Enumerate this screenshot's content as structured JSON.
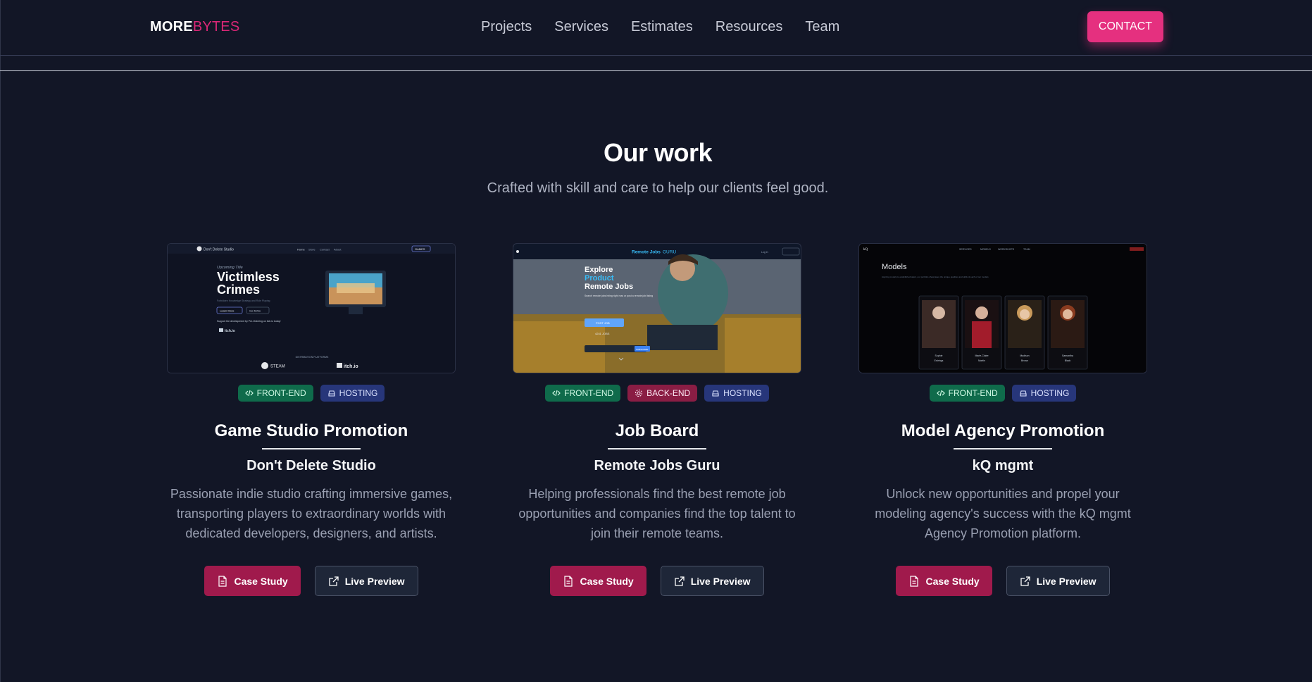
{
  "nav": {
    "logo_a": "MORE",
    "logo_b": "BYTES",
    "items": [
      "Projects",
      "Services",
      "Estimates",
      "Resources",
      "Team"
    ],
    "contact": "CONTACT"
  },
  "section": {
    "title": "Our work",
    "subtitle": "Crafted with skill and care to help our clients feel good."
  },
  "projects": [
    {
      "tags": [
        "FRONT-END",
        "HOSTING"
      ],
      "title": "Game Studio Promotion",
      "client": "Don't Delete Studio",
      "description": "Passionate indie studio crafting immersive games, transporting players to extraordinary worlds with dedicated developers, designers, and artists.",
      "case_label": "Case Study",
      "live_label": "Live Preview",
      "preview": {
        "brand": "Don't Delete Studio",
        "nav": [
          "Home",
          "Store",
          "Contact",
          "About"
        ],
        "badge": "GAMES",
        "eyebrow": "Upcoming Title",
        "headline": "Victimless Crimes",
        "tagline": "Forbidden Knowledge Strategy and Role Playing",
        "btn1": "Learn More",
        "btn2": "Go Itchio",
        "support": "Support the development by Pre-Ordering on itch.io today!",
        "itch_small": "itch.io",
        "platforms_label": "DISTRIBUTION PLATFORMS",
        "steam": "STEAM",
        "itch": "itch.io"
      }
    },
    {
      "tags": [
        "FRONT-END",
        "BACK-END",
        "HOSTING"
      ],
      "title": "Job Board",
      "client": "Remote Jobs Guru",
      "description": "Helping professionals find the best remote job opportunities and companies find the top talent to join their remote teams.",
      "case_label": "Case Study",
      "live_label": "Live Preview",
      "preview": {
        "brand_a": "Remote Jobs",
        "brand_b": "GURU",
        "login": "Log in",
        "headline_1": "Explore",
        "headline_2": "Product",
        "headline_3": "Remote Jobs",
        "sub": "Search remote jobs hiring right now or post a remote job listing",
        "post_btn": "POST JOB",
        "count": "4241 JOBS",
        "subscribe": "SUBSCRIBE"
      }
    },
    {
      "tags": [
        "FRONT-END",
        "HOSTING"
      ],
      "title": "Model Agency Promotion",
      "client": "kQ mgmt",
      "description": "Unlock new opportunities and propel your modeling agency's success with the kQ mgmt Agency Promotion platform.",
      "case_label": "Case Study",
      "live_label": "Live Preview",
      "preview": {
        "logo": "kQ",
        "nav": [
          "SERVICES",
          "MODELS",
          "WORKSHOPS",
          "TEAM"
        ],
        "heading": "Models",
        "sub": "Aspiring models to established talent, our portfolio showcases the unique qualities and skills of each of our models",
        "models": [
          {
            "name": "Sophie Estrings",
            "color": "#3b2a26"
          },
          {
            "name": "Marie-Claire Martin",
            "color": "#a21c2b"
          },
          {
            "name": "Madison Brown",
            "color": "#c99a5b"
          },
          {
            "name": "Samantha Black",
            "color": "#8a3b1f"
          }
        ]
      }
    }
  ],
  "colors": {
    "accent": "#e5307f",
    "background": "#121626",
    "frontend": "#0f6b4b",
    "backend": "#8a1d44",
    "hosting": "#27367a"
  }
}
